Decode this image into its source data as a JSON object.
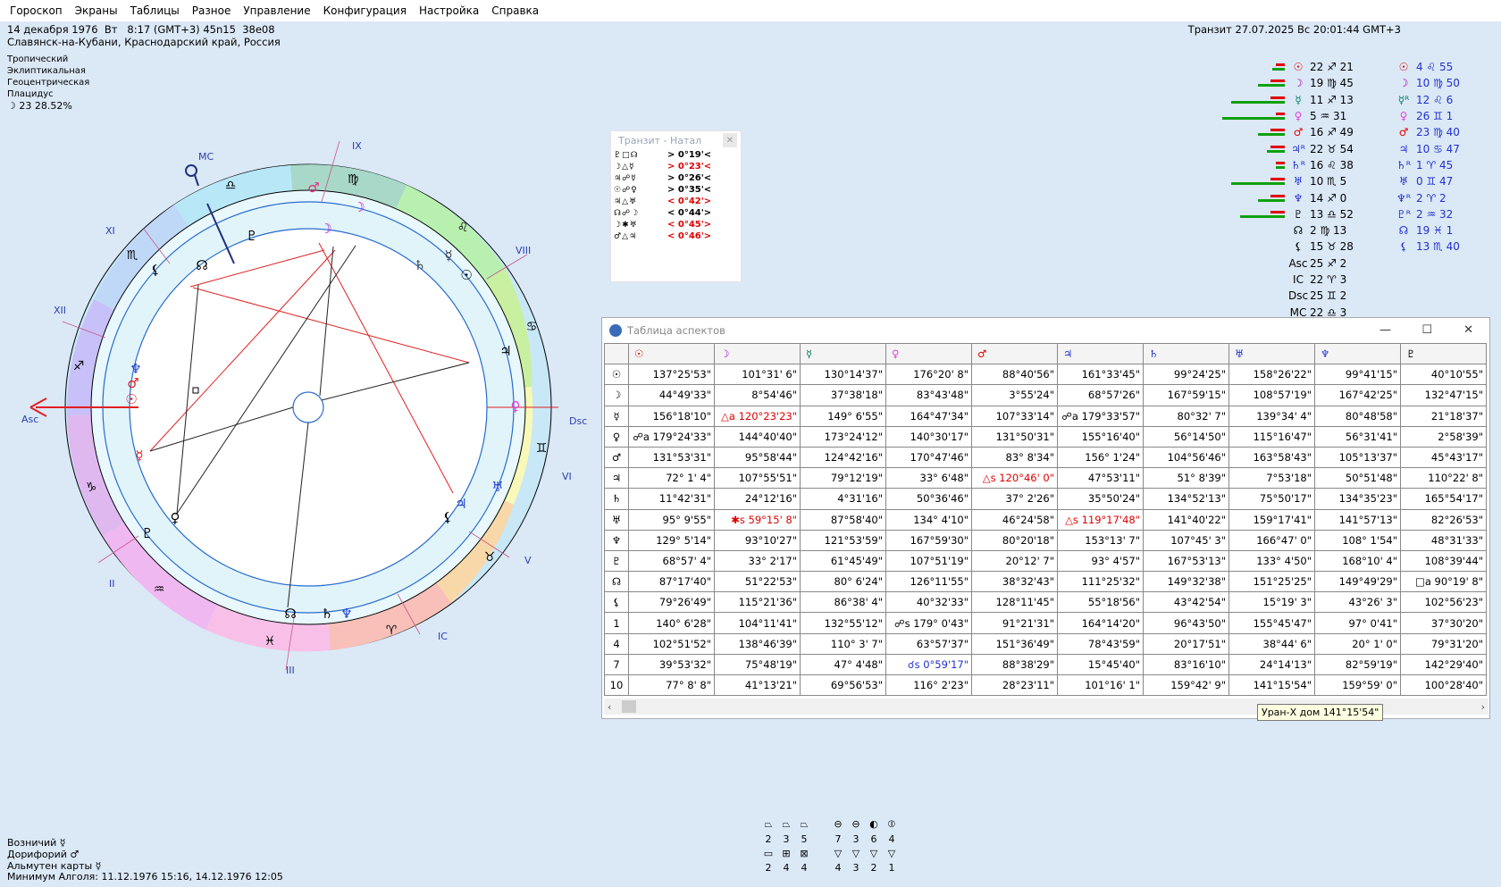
{
  "menu": [
    "Гороскоп",
    "Экраны",
    "Таблицы",
    "Разное",
    "Управление",
    "Конфигурация",
    "Настройка",
    "Справка"
  ],
  "chart_info": {
    "line1": "14 декабря 1976  Вт   8:17 (GMT+3) 45n15  38e08",
    "line2": "Славянск-на-Кубани, Краснодарский край, Россия",
    "z1": "Тропический",
    "z2": "Эклиптикальная",
    "z3": "Геоцентрическая",
    "z4": "Плацидус",
    "moon": "☽   23 28.52%"
  },
  "transit_header": "Транзит 27.07.2025  Вс 20:01:44 GMT+3",
  "wheel": {
    "mc": "MC",
    "ic": "IC",
    "asc": "Asc",
    "dsc": "Dsc",
    "houses": [
      "IX",
      "VIII",
      "VII",
      "VI",
      "V",
      "III",
      "II",
      "XII",
      "XI"
    ]
  },
  "popup": {
    "title": "Транзит - Натал",
    "rows": [
      {
        "g": "♇□☊",
        "v": ">  0°19'<",
        "c": "#000"
      },
      {
        "g": "☽△☿",
        "v": ">  0°23'<",
        "c": "#e00000"
      },
      {
        "g": "♃☍☿",
        "v": ">  0°26'<",
        "c": "#000"
      },
      {
        "g": "☉☍♀",
        "v": ">  0°35'<",
        "c": "#000"
      },
      {
        "g": "♃△♅",
        "v": "<  0°42'>",
        "c": "#e00000"
      },
      {
        "g": "☊☍☽",
        "v": "<  0°44'>",
        "c": "#000"
      },
      {
        "g": "☽✱♅",
        "v": "<  0°45'>",
        "c": "#e00000"
      },
      {
        "g": "♂△♃",
        "v": "<  0°46'>",
        "c": "#e00000"
      }
    ]
  },
  "planets": [
    {
      "g1": "☉",
      "c1": "#e00000",
      "d1": "22 ♐ 21",
      "g2": "☉",
      "c2": "#e00000",
      "d2": "4 ♌ 55",
      "bar": [
        14,
        10
      ]
    },
    {
      "g1": "☽",
      "c1": "#a000c0",
      "d1": "19 ♍ 45",
      "g2": "☽",
      "c2": "#a000c0",
      "d2": "10 ♍ 50",
      "bar": [
        30,
        16
      ]
    },
    {
      "g1": "☿",
      "c1": "#008060",
      "d1": "11 ♐ 13",
      "g2": "☿ᴿ",
      "c2": "#008060",
      "d2": "12 ♌ 6",
      "bar": [
        60,
        16
      ]
    },
    {
      "g1": "♀",
      "c1": "#e040e0",
      "d1": "5 ♒ 31",
      "g2": "♀",
      "c2": "#e040e0",
      "d2": "26 ♊ 1",
      "bar": [
        70,
        10
      ]
    },
    {
      "g1": "♂",
      "c1": "#e00000",
      "d1": "16 ♐ 49",
      "g2": "♂",
      "c2": "#e00000",
      "d2": "23 ♍ 40",
      "bar": [
        30,
        16
      ]
    },
    {
      "g1": "♃ᴿ",
      "c1": "#2030d0",
      "d1": "22 ♉ 54",
      "g2": "♃",
      "c2": "#2030d0",
      "d2": "10 ♋ 47",
      "bar": [
        20,
        16
      ]
    },
    {
      "g1": "♄ᴿ",
      "c1": "#2030d0",
      "d1": "16 ♌ 38",
      "g2": "♄ᴿ",
      "c2": "#2030d0",
      "d2": "1 ♈ 45",
      "bar": [
        10,
        10
      ]
    },
    {
      "g1": "♅",
      "c1": "#2030d0",
      "d1": "10 ♏ 5",
      "g2": "♅",
      "c2": "#2030d0",
      "d2": "0 ♊ 47",
      "bar": [
        60,
        16
      ]
    },
    {
      "g1": "♆",
      "c1": "#2030d0",
      "d1": "14 ♐ 0",
      "g2": "♆ᴿ",
      "c2": "#2030d0",
      "d2": "2 ♈ 2",
      "bar": [
        30,
        16
      ]
    },
    {
      "g1": "♇",
      "c1": "#000",
      "d1": "13 ♎ 52",
      "g2": "♇ᴿ",
      "c2": "#2030d0",
      "d2": "2 ♒ 32",
      "bar": [
        50,
        16
      ]
    },
    {
      "g1": "☊",
      "c1": "#000",
      "d1": "2 ♍ 13",
      "g2": "☊",
      "c2": "#2030d0",
      "d2": "19 ♓ 1",
      "bar": [
        0,
        0
      ]
    },
    {
      "g1": "⚸",
      "c1": "#000",
      "d1": "15 ♉ 28",
      "g2": "⚸",
      "c2": "#2030d0",
      "d2": "13 ♏ 40",
      "bar": [
        0,
        0
      ]
    },
    {
      "g1": "Asc",
      "c1": "#000",
      "d1": "25 ♐ 2",
      "g2": "",
      "c2": "#000",
      "d2": "",
      "bar": [
        0,
        0
      ]
    },
    {
      "g1": "IC",
      "c1": "#000",
      "d1": "22 ♈ 3",
      "g2": "",
      "c2": "#000",
      "d2": "",
      "bar": [
        0,
        0
      ]
    },
    {
      "g1": "Dsc",
      "c1": "#000",
      "d1": "25 ♊ 2",
      "g2": "",
      "c2": "#000",
      "d2": "",
      "bar": [
        0,
        0
      ]
    },
    {
      "g1": "MC",
      "c1": "#000",
      "d1": "22 ♎ 3",
      "g2": "",
      "c2": "#000",
      "d2": "",
      "bar": [
        0,
        0
      ]
    }
  ],
  "aspect_table": {
    "title": "Таблица аспектов",
    "headers": [
      "☉",
      "☽",
      "☿",
      "♀",
      "♂",
      "♃",
      "♄",
      "♅",
      "♆",
      "♇"
    ],
    "rows": [
      {
        "h": "☉",
        "c": [
          "137°25'53\"",
          "101°31' 6\"",
          "130°14'37\"",
          "176°20' 8\"",
          "88°40'56\"",
          "161°33'45\"",
          "99°24'25\"",
          "158°26'22\"",
          "99°41'15\"",
          "40°10'55\""
        ]
      },
      {
        "h": "☽",
        "c": [
          "44°49'33\"",
          "8°54'46\"",
          "37°38'18\"",
          "83°43'48\"",
          "3°55'24\"",
          "68°57'26\"",
          "167°59'15\"",
          "108°57'19\"",
          "167°42'25\"",
          "132°47'15\""
        ]
      },
      {
        "h": "☿",
        "c": [
          "156°18'10\"",
          "△a 120°23'23\"",
          "149° 6'55\"",
          "164°47'34\"",
          "107°33'14\"",
          "☍a 179°33'57\"",
          "80°32' 7\"",
          "139°34' 4\"",
          "80°48'58\"",
          "21°18'37\""
        ]
      },
      {
        "h": "♀",
        "c": [
          "☍a 179°24'33\"",
          "144°40'40\"",
          "173°24'12\"",
          "140°30'17\"",
          "131°50'31\"",
          "155°16'40\"",
          "56°14'50\"",
          "115°16'47\"",
          "56°31'41\"",
          "2°58'39\""
        ]
      },
      {
        "h": "♂",
        "c": [
          "131°53'31\"",
          "95°58'44\"",
          "124°42'16\"",
          "170°47'46\"",
          "83° 8'34\"",
          "156° 1'24\"",
          "104°56'46\"",
          "163°58'43\"",
          "105°13'37\"",
          "45°43'17\""
        ]
      },
      {
        "h": "♃",
        "c": [
          "72° 1' 4\"",
          "107°55'51\"",
          "79°12'19\"",
          "33° 6'48\"",
          "△s 120°46' 0\"",
          "47°53'11\"",
          "51° 8'39\"",
          "7°53'18\"",
          "50°51'48\"",
          "110°22' 8\""
        ]
      },
      {
        "h": "♄",
        "c": [
          "11°42'31\"",
          "24°12'16\"",
          "4°31'16\"",
          "50°36'46\"",
          "37° 2'26\"",
          "35°50'24\"",
          "134°52'13\"",
          "75°50'17\"",
          "134°35'23\"",
          "165°54'17\""
        ]
      },
      {
        "h": "♅",
        "c": [
          "95° 9'55\"",
          "✱s 59°15' 8\"",
          "87°58'40\"",
          "134° 4'10\"",
          "46°24'58\"",
          "△s 119°17'48\"",
          "141°40'22\"",
          "159°17'41\"",
          "141°57'13\"",
          "82°26'53\""
        ]
      },
      {
        "h": "♆",
        "c": [
          "129° 5'14\"",
          "93°10'27\"",
          "121°53'59\"",
          "167°59'30\"",
          "80°20'18\"",
          "153°13' 7\"",
          "107°45' 3\"",
          "166°47' 0\"",
          "108° 1'54\"",
          "48°31'33\""
        ]
      },
      {
        "h": "♇",
        "c": [
          "68°57' 4\"",
          "33° 2'17\"",
          "61°45'49\"",
          "107°51'19\"",
          "20°12' 7\"",
          "93° 4'57\"",
          "167°53'13\"",
          "133° 4'50\"",
          "168°10' 4\"",
          "108°39'44\""
        ]
      },
      {
        "h": "☊",
        "c": [
          "87°17'40\"",
          "51°22'53\"",
          "80° 6'24\"",
          "126°11'55\"",
          "38°32'43\"",
          "111°25'32\"",
          "149°32'38\"",
          "151°25'25\"",
          "149°49'29\"",
          "□a 90°19' 8\""
        ]
      },
      {
        "h": "⚸",
        "c": [
          "79°26'49\"",
          "115°21'36\"",
          "86°38' 4\"",
          "40°32'33\"",
          "128°11'45\"",
          "55°18'56\"",
          "43°42'54\"",
          "15°19' 3\"",
          "43°26' 3\"",
          "102°56'23\""
        ]
      },
      {
        "h": "1",
        "c": [
          "140° 6'28\"",
          "104°11'41\"",
          "132°55'12\"",
          "☍s 179° 0'43\"",
          "91°21'31\"",
          "164°14'20\"",
          "96°43'50\"",
          "155°45'47\"",
          "97° 0'41\"",
          "37°30'20\""
        ]
      },
      {
        "h": "4",
        "c": [
          "102°51'52\"",
          "138°46'39\"",
          "110° 3' 7\"",
          "63°57'37\"",
          "151°36'49\"",
          "78°43'59\"",
          "20°17'51\"",
          "38°44' 6\"",
          "20° 1' 0\"",
          "79°31'20\""
        ]
      },
      {
        "h": "7",
        "c": [
          "39°53'32\"",
          "75°48'19\"",
          "47° 4'48\"",
          "☌s 0°59'17\"",
          "88°38'29\"",
          "15°45'40\"",
          "83°16'10\"",
          "24°14'13\"",
          "82°59'19\"",
          "142°29'40\""
        ]
      },
      {
        "h": "10",
        "c": [
          "77° 8' 8\"",
          "41°13'21\"",
          "69°56'53\"",
          "116° 2'23\"",
          "28°23'11\"",
          "101°16' 1\"",
          "159°42' 9\"",
          "141°15'54\"",
          "159°59' 0\"",
          "100°28'40\""
        ]
      }
    ]
  },
  "tooltip": "Уран-X дом  141°15'54\"",
  "bottom": {
    "l1": "Возничий ☿",
    "l2": "Дорифорий ♂",
    "l3": "Альмутен карты ☿",
    "l4": "Минимум Алголя: 11.12.1976 15:16,  14.12.1976 12:05"
  },
  "shape_counts": {
    "top": [
      "2",
      "3",
      "5",
      "7",
      "3",
      "6",
      "4"
    ],
    "bottom": [
      "2",
      "4",
      "4",
      "4",
      "3",
      "2",
      "1"
    ]
  }
}
